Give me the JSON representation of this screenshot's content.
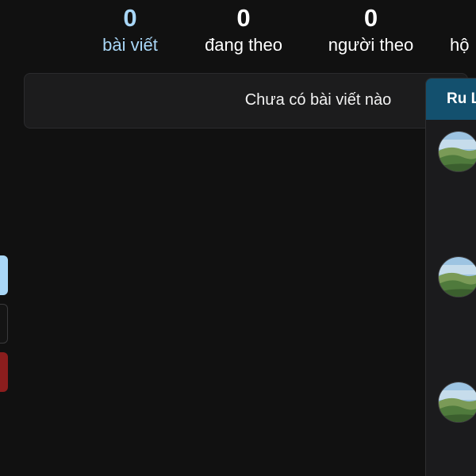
{
  "stats": {
    "posts": {
      "count": "0",
      "label": "bài viết"
    },
    "following": {
      "count": "0",
      "label": "đang theo"
    },
    "followers": {
      "count": "0",
      "label": "người theo"
    },
    "groups": {
      "label": "hộ"
    }
  },
  "posts_panel": {
    "empty_message": "Chưa có bài viết nào"
  },
  "side_panel": {
    "title": "Ru L",
    "items": [
      {
        "avatar_icon": "landscape-avatar-icon"
      },
      {
        "avatar_icon": "landscape-avatar-icon"
      },
      {
        "avatar_icon": "landscape-avatar-icon"
      }
    ]
  },
  "colors": {
    "background": "#111111",
    "accent": "#a9d7f7",
    "panel": "#1c1c1d",
    "header": "#13506e",
    "danger": "#8b1d1d"
  }
}
